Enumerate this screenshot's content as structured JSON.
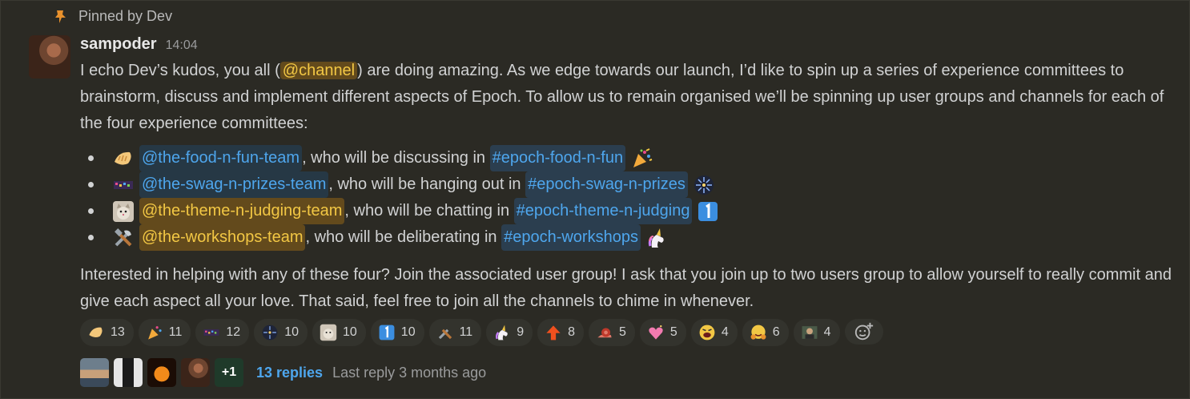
{
  "pinned": {
    "icon": "pin-icon",
    "text": "Pinned by Dev"
  },
  "message": {
    "author": "sampoder",
    "time": "14:04",
    "intro_1": "I echo Dev’s kudos, you all (",
    "channel_mention": "@channel",
    "intro_2": ") are doing amazing. As we edge towards our launch, I’d like to spin up a series of experience committees to brainstorm, discuss and implement different aspects of Epoch. To allow us to remain organised we’ll be spinning up user groups and channels for each of the four experience committees:",
    "items": [
      {
        "emoji": "dumpling-emoji",
        "group": "@the-food-n-fun-team",
        "mid": ", who will be discussing in ",
        "channel": "#epoch-food-n-fun",
        "trail": "party-popper-emoji"
      },
      {
        "emoji": "pixel-flair-emoji",
        "group": "@the-swag-n-prizes-team",
        "mid": ", who will be hanging out in ",
        "channel": "#epoch-swag-n-prizes",
        "trail": "fireworks-emoji"
      },
      {
        "emoji": "cat-emoji",
        "group": "@the-theme-n-judging-team",
        "mid": ", who will be chatting in ",
        "channel": "#epoch-theme-n-judging",
        "trail": "keycap-one-emoji"
      },
      {
        "emoji": "tools-emoji",
        "group": "@the-workshops-team",
        "mid": ", who will be deliberating in ",
        "channel": "#epoch-workshops",
        "trail": "unicorn-emoji"
      }
    ],
    "outro": "Interested in helping with any of these four? Join the associated user group! I ask that you join up to two users group to allow yourself to really commit and give each aspect all your love. That said, feel free to join all the channels to chime in whenever."
  },
  "reactions": [
    {
      "icon": "dumpling-emoji",
      "count": "13"
    },
    {
      "icon": "party-popper-emoji",
      "count": "11"
    },
    {
      "icon": "pixel-flair-emoji",
      "count": "12"
    },
    {
      "icon": "fireworks-emoji",
      "count": "10"
    },
    {
      "icon": "cat-emoji",
      "count": "10"
    },
    {
      "icon": "keycap-one-emoji",
      "count": "10"
    },
    {
      "icon": "tools-emoji",
      "count": "11"
    },
    {
      "icon": "unicorn-emoji",
      "count": "9"
    },
    {
      "icon": "arrow-up-emoji",
      "count": "8"
    },
    {
      "icon": "snail-emoji",
      "count": "5"
    },
    {
      "icon": "sparkling-heart-emoji",
      "count": "5"
    },
    {
      "icon": "shouting-face-emoji",
      "count": "4"
    },
    {
      "icon": "hugging-face-emoji",
      "count": "6"
    },
    {
      "icon": "person-photo-emoji",
      "count": "4"
    }
  ],
  "add_reaction_icon": "add-reaction-icon",
  "thread": {
    "more": "+1",
    "replies": "13 replies",
    "last_reply": "Last reply 3 months ago"
  },
  "colors": {
    "background": "#2b2a24",
    "mention_bg": "#634a1c",
    "mention_text": "#f2c744",
    "link": "#4ea6ed",
    "reaction_bg": "#33332d"
  }
}
